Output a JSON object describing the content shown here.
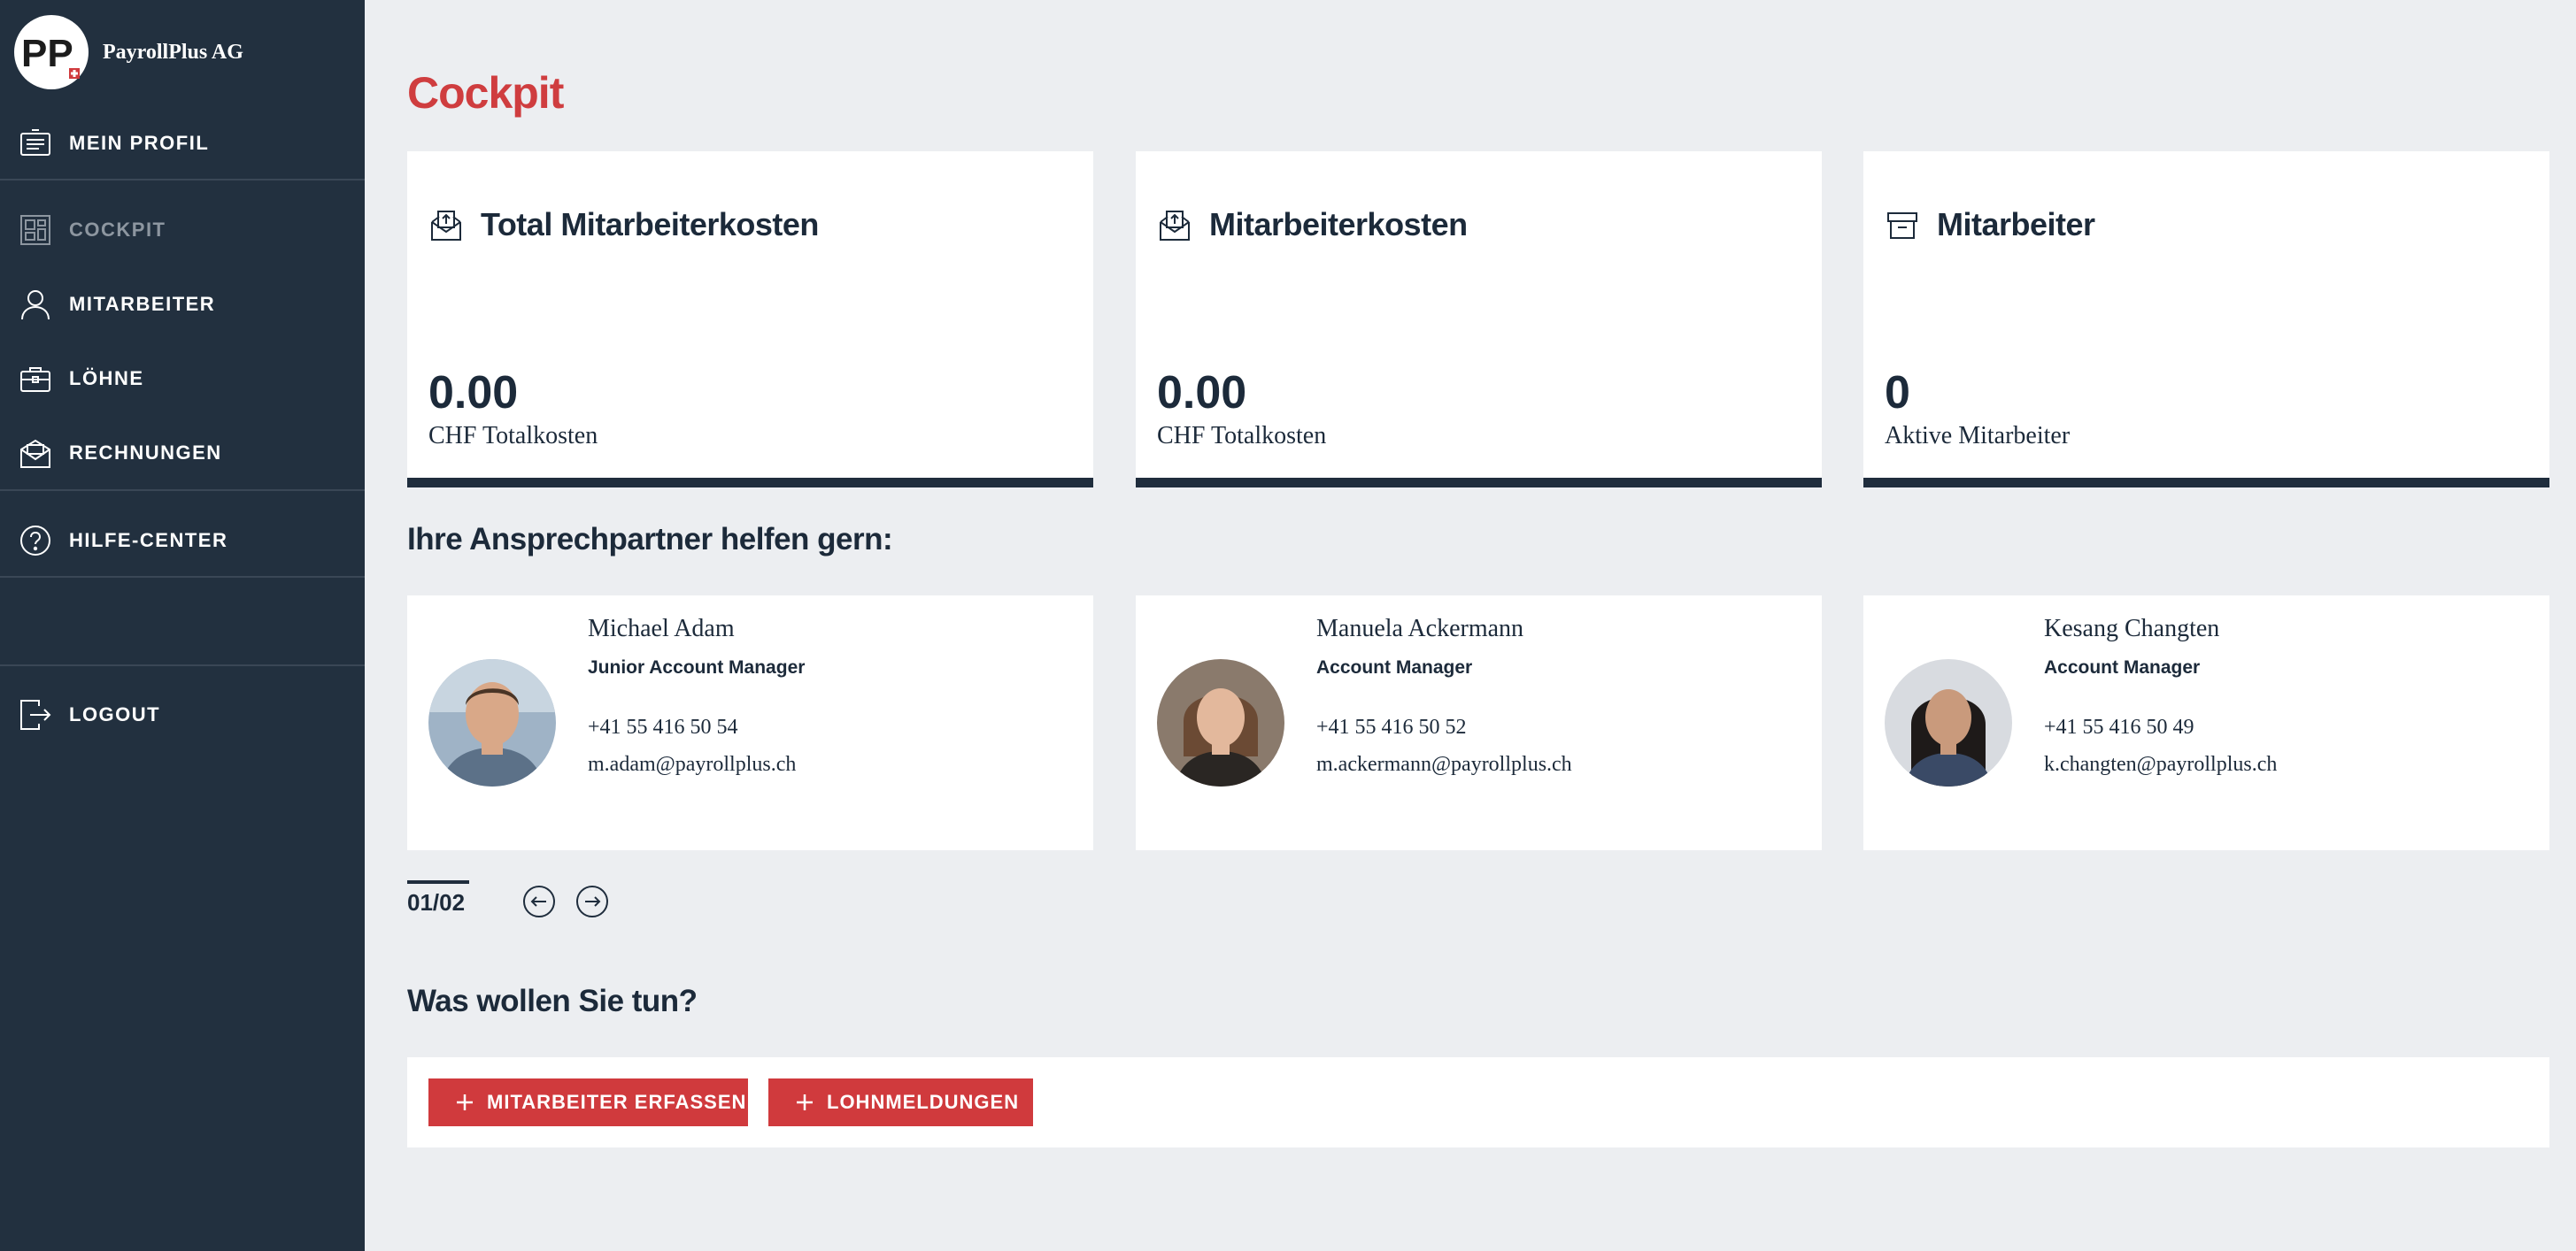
{
  "brand": {
    "name": "PayrollPlus AG",
    "logo_text": "PP"
  },
  "sidebar": {
    "items": [
      {
        "label": "MEIN PROFIL",
        "icon": "profile-card-icon"
      },
      {
        "label": "COCKPIT",
        "icon": "dashboard-icon",
        "active": true
      },
      {
        "label": "MITARBEITER",
        "icon": "person-icon"
      },
      {
        "label": "LÖHNE",
        "icon": "briefcase-icon"
      },
      {
        "label": "RECHNUNGEN",
        "icon": "envelope-icon"
      },
      {
        "label": "HILFE-CENTER",
        "icon": "help-icon"
      },
      {
        "label": "LOGOUT",
        "icon": "logout-icon"
      }
    ]
  },
  "page": {
    "title": "Cockpit"
  },
  "stats": [
    {
      "title": "Total Mitarbeiterkosten",
      "value": "0.00",
      "sub": "CHF Totalkosten",
      "icon": "envelope-upload-icon"
    },
    {
      "title": "Mitarbeiterkosten",
      "value": "0.00",
      "sub": "CHF Totalkosten",
      "icon": "envelope-upload-icon"
    },
    {
      "title": "Mitarbeiter",
      "value": "0",
      "sub": "Aktive Mitarbeiter",
      "icon": "archive-box-icon"
    }
  ],
  "contacts_section": {
    "title": "Ihre Ansprechpartner helfen gern:"
  },
  "contacts": [
    {
      "name": "Michael Adam",
      "role": "Junior Account Manager",
      "phone": "+41 55 416 50 54",
      "email": "m.adam@payrollplus.ch"
    },
    {
      "name": "Manuela Ackermann",
      "role": "Account Manager",
      "phone": "+41 55 416 50 52",
      "email": "m.ackermann@payrollplus.ch"
    },
    {
      "name": "Kesang Changten",
      "role": "Account Manager",
      "phone": "+41 55 416 50 49",
      "email": "k.changten@payrollplus.ch"
    }
  ],
  "pager": {
    "text": "01/02"
  },
  "actions_section": {
    "title": "Was wollen Sie tun?"
  },
  "actions": [
    {
      "label": "MITARBEITER ERFASSEN"
    },
    {
      "label": "LOHNMELDUNGEN"
    }
  ],
  "colors": {
    "sidebar": "#22303f",
    "accent": "#cf3d3f",
    "navy": "#1f2d3d",
    "background": "#eceef1"
  }
}
